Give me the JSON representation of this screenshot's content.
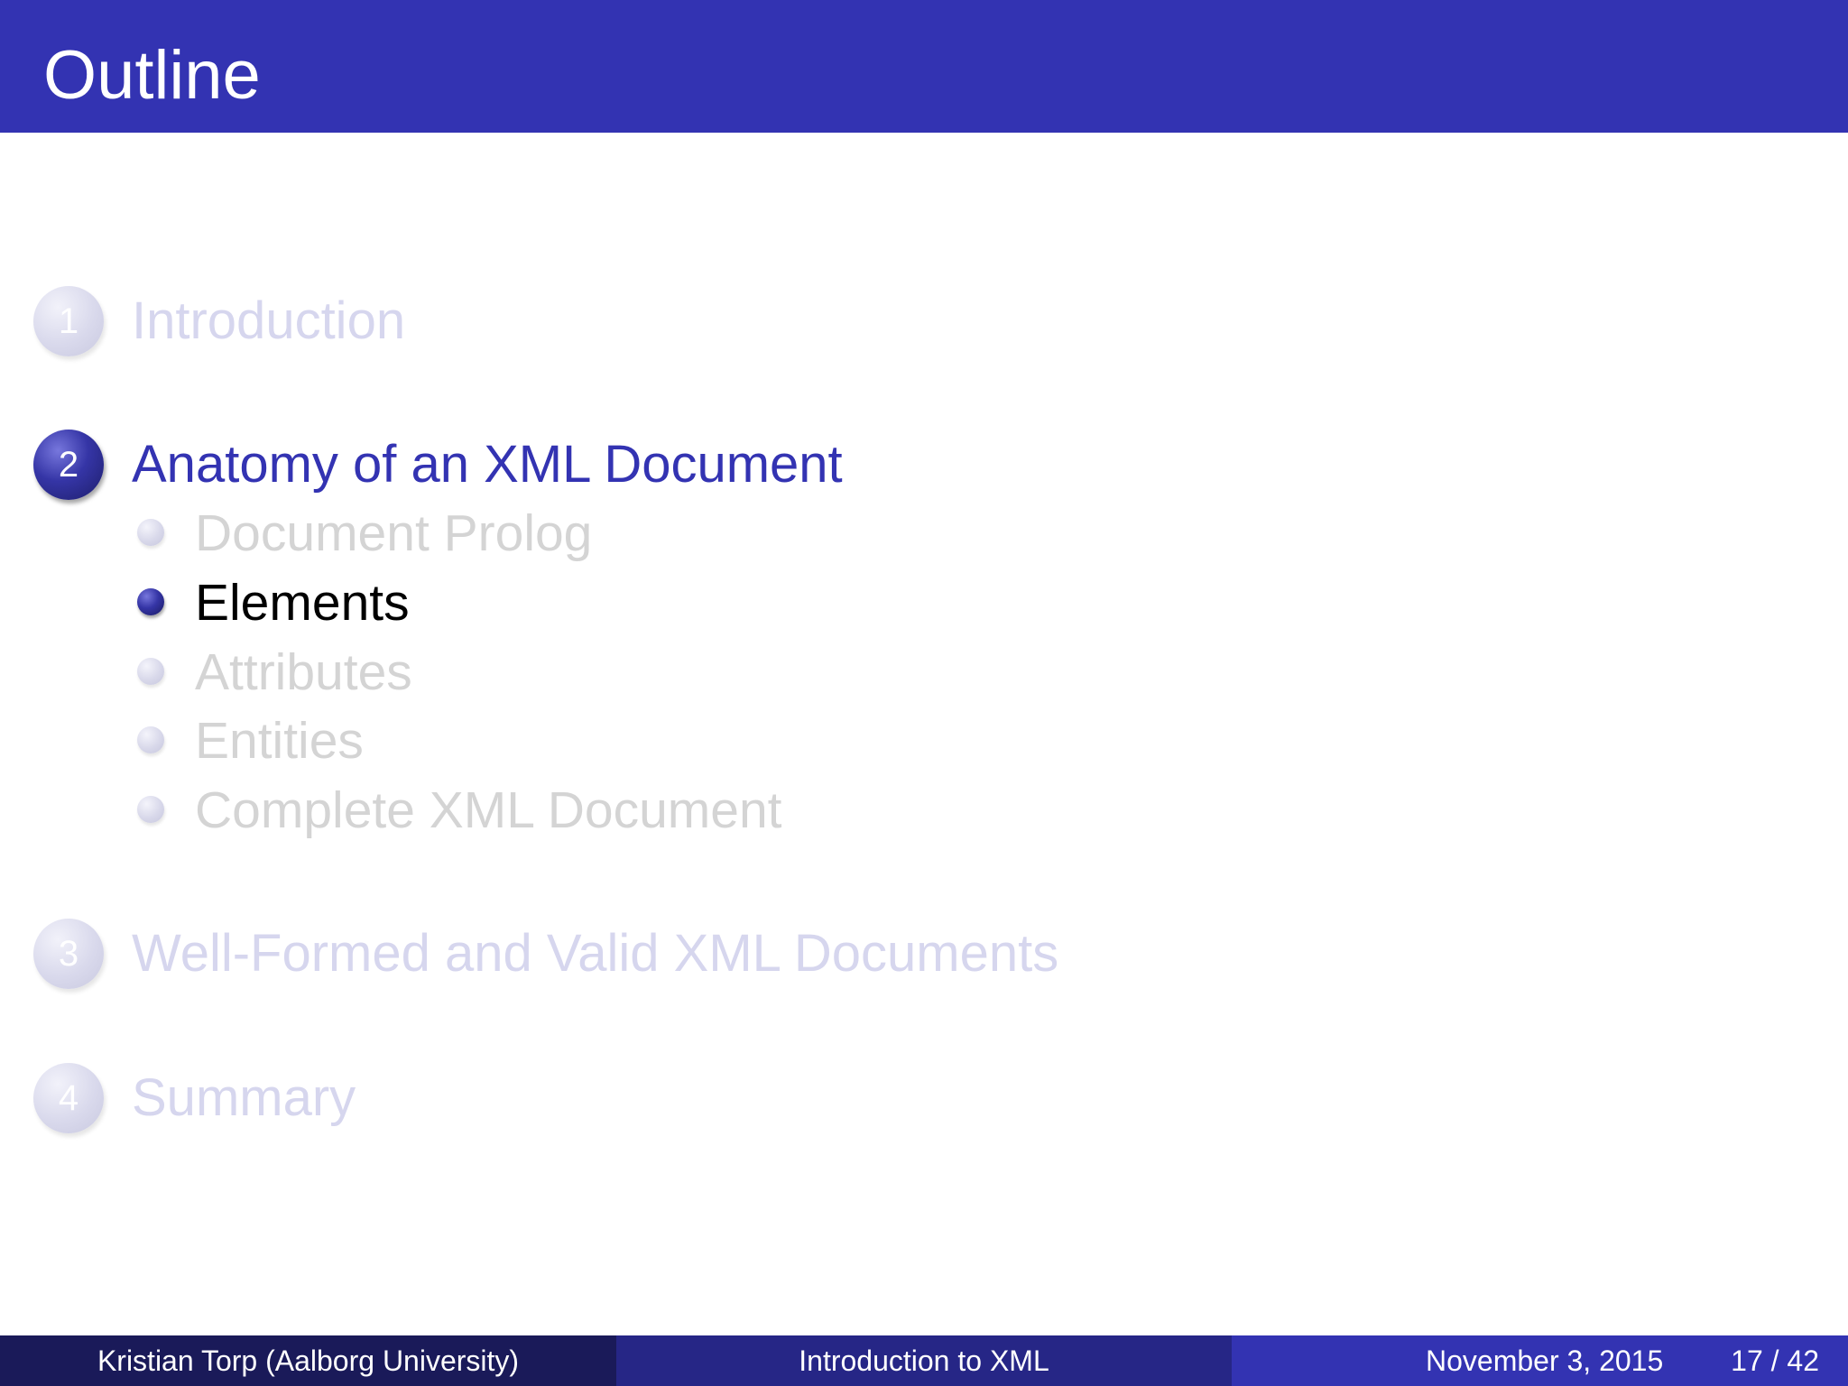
{
  "frame": {
    "title": "Outline"
  },
  "toc": {
    "sections": [
      {
        "number": "1",
        "label": "Introduction",
        "state": "inactive"
      },
      {
        "number": "2",
        "label": "Anatomy of an XML Document",
        "state": "active"
      },
      {
        "number": "3",
        "label": "Well-Formed and Valid XML Documents",
        "state": "inactive"
      },
      {
        "number": "4",
        "label": "Summary",
        "state": "inactive"
      }
    ],
    "subsections": [
      {
        "label": "Document Prolog",
        "state": "inactive"
      },
      {
        "label": "Elements",
        "state": "active"
      },
      {
        "label": "Attributes",
        "state": "inactive"
      },
      {
        "label": "Entities",
        "state": "inactive"
      },
      {
        "label": "Complete XML Document",
        "state": "inactive"
      }
    ]
  },
  "footer": {
    "author": "Kristian Torp  (Aalborg University)",
    "title": "Introduction to XML",
    "date": "November 3, 2015",
    "page": "17 / 42"
  },
  "colors": {
    "header_background": "#3333b2",
    "active_section": "#3333b2",
    "inactive_section": "#d6d6ee",
    "active_subsection": "#000000",
    "inactive_subsection": "#d4d4d4",
    "footer_left": "#1a1a59",
    "footer_center": "#262686",
    "footer_right": "#3333b2"
  }
}
